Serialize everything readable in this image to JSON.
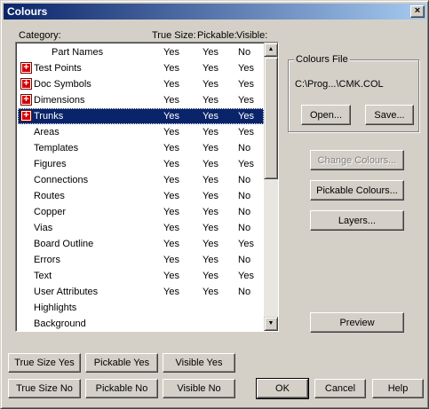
{
  "window": {
    "title": "Colours",
    "close_glyph": "×"
  },
  "headers": {
    "category": "Category:",
    "true_size": "True Size:",
    "pickable": "Pickable:",
    "visible": "Visible:"
  },
  "rows": [
    {
      "name": "Part Names",
      "true_size": "Yes",
      "pickable": "Yes",
      "visible": "No",
      "expandable": false,
      "selected": false
    },
    {
      "name": "Test Points",
      "true_size": "Yes",
      "pickable": "Yes",
      "visible": "Yes",
      "expandable": true,
      "selected": false
    },
    {
      "name": "Doc Symbols",
      "true_size": "Yes",
      "pickable": "Yes",
      "visible": "Yes",
      "expandable": true,
      "selected": false
    },
    {
      "name": "Dimensions",
      "true_size": "Yes",
      "pickable": "Yes",
      "visible": "Yes",
      "expandable": true,
      "selected": false
    },
    {
      "name": "Trunks",
      "true_size": "Yes",
      "pickable": "Yes",
      "visible": "Yes",
      "expandable": true,
      "selected": true
    },
    {
      "name": "Areas",
      "true_size": "Yes",
      "pickable": "Yes",
      "visible": "Yes",
      "expandable": false,
      "selected": false
    },
    {
      "name": "Templates",
      "true_size": "Yes",
      "pickable": "Yes",
      "visible": "No",
      "expandable": false,
      "selected": false
    },
    {
      "name": "Figures",
      "true_size": "Yes",
      "pickable": "Yes",
      "visible": "Yes",
      "expandable": false,
      "selected": false
    },
    {
      "name": "Connections",
      "true_size": "Yes",
      "pickable": "Yes",
      "visible": "No",
      "expandable": false,
      "selected": false
    },
    {
      "name": "Routes",
      "true_size": "Yes",
      "pickable": "Yes",
      "visible": "No",
      "expandable": false,
      "selected": false
    },
    {
      "name": "Copper",
      "true_size": "Yes",
      "pickable": "Yes",
      "visible": "No",
      "expandable": false,
      "selected": false
    },
    {
      "name": "Vias",
      "true_size": "Yes",
      "pickable": "Yes",
      "visible": "No",
      "expandable": false,
      "selected": false
    },
    {
      "name": "Board Outline",
      "true_size": "Yes",
      "pickable": "Yes",
      "visible": "Yes",
      "expandable": false,
      "selected": false
    },
    {
      "name": "Errors",
      "true_size": "Yes",
      "pickable": "Yes",
      "visible": "No",
      "expandable": false,
      "selected": false
    },
    {
      "name": "Text",
      "true_size": "Yes",
      "pickable": "Yes",
      "visible": "Yes",
      "expandable": false,
      "selected": false
    },
    {
      "name": "User Attributes",
      "true_size": "Yes",
      "pickable": "Yes",
      "visible": "No",
      "expandable": false,
      "selected": false
    },
    {
      "name": "Highlights",
      "true_size": "",
      "pickable": "",
      "visible": "",
      "expandable": false,
      "selected": false
    },
    {
      "name": "Background",
      "true_size": "",
      "pickable": "",
      "visible": "",
      "expandable": false,
      "selected": false
    }
  ],
  "scrollbar": {
    "up_glyph": "▲",
    "down_glyph": "▼"
  },
  "colours_file": {
    "label": "Colours File",
    "path": "C:\\Prog...\\CMK.COL",
    "open_label": "Open...",
    "save_label": "Save..."
  },
  "side_buttons": {
    "change_colours": "Change Colours...",
    "pickable_colours": "Pickable Colours...",
    "layers": "Layers...",
    "preview": "Preview"
  },
  "bottom_buttons": {
    "true_size_yes": "True Size Yes",
    "pickable_yes": "Pickable Yes",
    "visible_yes": "Visible Yes",
    "true_size_no": "True Size No",
    "pickable_no": "Pickable No",
    "visible_no": "Visible No",
    "ok": "OK",
    "cancel": "Cancel",
    "help": "Help"
  },
  "colors": {
    "face": "#d4d0c8",
    "title_start": "#0a246a",
    "title_end": "#a6caf0",
    "selection": "#0a246a",
    "expand_icon": "#d40000"
  }
}
